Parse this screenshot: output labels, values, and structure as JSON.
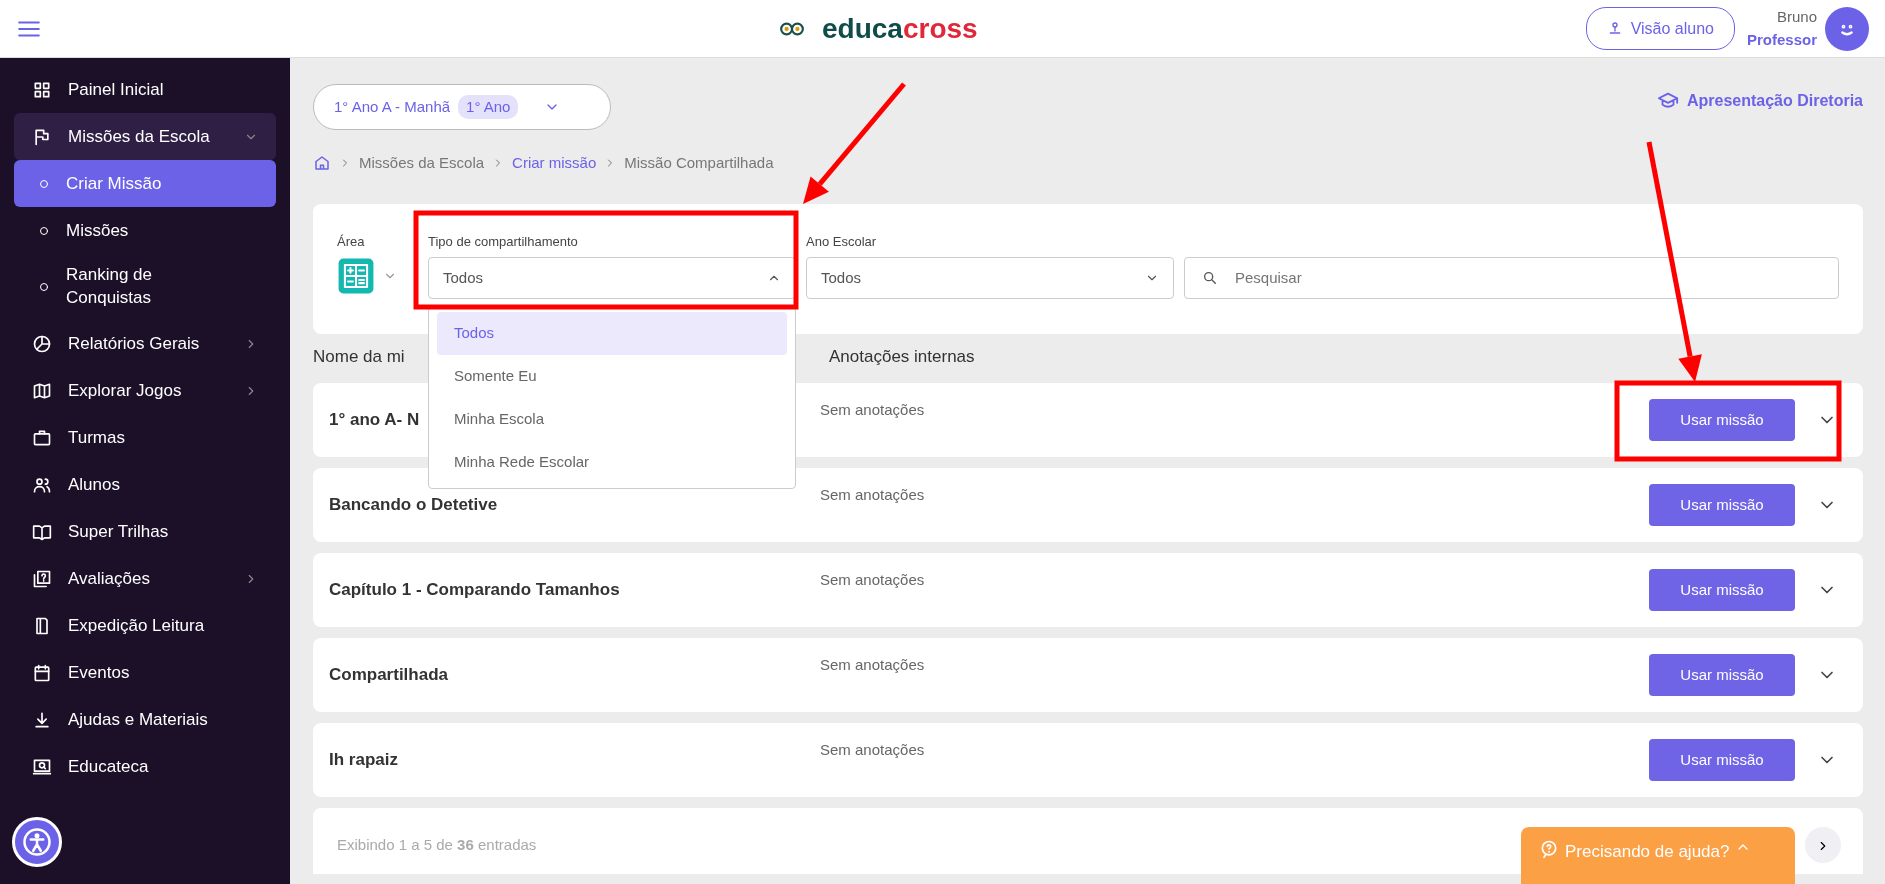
{
  "header": {
    "logo": {
      "part_1": "educa",
      "part_2": "cross"
    },
    "student_view_button": "Visão aluno",
    "user": {
      "name": "Bruno",
      "role": "Professor"
    }
  },
  "sidebar": {
    "items": [
      {
        "label": "Painel Inicial",
        "selected": false
      },
      {
        "label": "Missões da Escola",
        "selected": false,
        "expanded": true,
        "children": [
          {
            "label": "Criar Missão",
            "selected": true
          },
          {
            "label": "Missões",
            "selected": false
          },
          {
            "label": "Ranking de Conquistas",
            "selected": false
          }
        ]
      },
      {
        "label": "Relatórios Gerais",
        "selected": false,
        "expanded": false
      },
      {
        "label": "Explorar Jogos",
        "selected": false,
        "expanded": false
      },
      {
        "label": "Turmas",
        "selected": false
      },
      {
        "label": "Alunos",
        "selected": false
      },
      {
        "label": "Super Trilhas",
        "selected": false
      },
      {
        "label": "Avaliações",
        "selected": false,
        "expanded": false
      },
      {
        "label": "Expedição Leitura",
        "selected": false
      },
      {
        "label": "Eventos",
        "selected": false
      },
      {
        "label": "Ajudas e Materiais",
        "selected": false
      },
      {
        "label": "Educateca",
        "selected": false
      }
    ]
  },
  "class_selector": {
    "label": "1° Ano A - Manhã",
    "badge": "1° Ano"
  },
  "presentation_link": "Apresentação Diretoria",
  "breadcrumb": [
    {
      "label": "Missões da Escola",
      "link": false
    },
    {
      "label": "Criar missão",
      "link": true
    },
    {
      "label": "Missão Compartilhada",
      "link": false
    }
  ],
  "filters": {
    "area_label": "Área",
    "sharing": {
      "label": "Tipo de compartilhamento",
      "value": "Todos",
      "expanded": true,
      "options": [
        {
          "label": "Todos",
          "selected": true
        },
        {
          "label": "Somente Eu",
          "selected": false
        },
        {
          "label": "Minha Escola",
          "selected": false
        },
        {
          "label": "Minha Rede Escolar",
          "selected": false
        }
      ]
    },
    "grade": {
      "label": "Ano Escolar",
      "value": "Todos"
    },
    "search": {
      "placeholder": "Pesquisar"
    }
  },
  "table": {
    "columns": [
      "Nome da mi",
      "Anotações internas"
    ],
    "rows": [
      {
        "name": "1° ano A- N",
        "notes": "Sem anotações",
        "button": "Usar missão"
      },
      {
        "name": "Bancando o Detetive",
        "notes": "Sem anotações",
        "button": "Usar missão"
      },
      {
        "name": "Capítulo 1 - Comparando Tamanhos",
        "notes": "Sem anotações",
        "button": "Usar missão"
      },
      {
        "name": "Compartilhada",
        "notes": "Sem anotações",
        "button": "Usar missão"
      },
      {
        "name": "Ih rapaiz",
        "notes": "Sem anotações",
        "button": "Usar missão"
      }
    ]
  },
  "footer": {
    "summary": "Exibindo 1 a 5 de **36** entradas"
  },
  "help_button": "Precisando de ajuda?",
  "annotations": [
    {
      "kind": "arrow"
    },
    {
      "kind": "box"
    },
    {
      "kind": "arrow"
    },
    {
      "kind": "box"
    }
  ]
}
